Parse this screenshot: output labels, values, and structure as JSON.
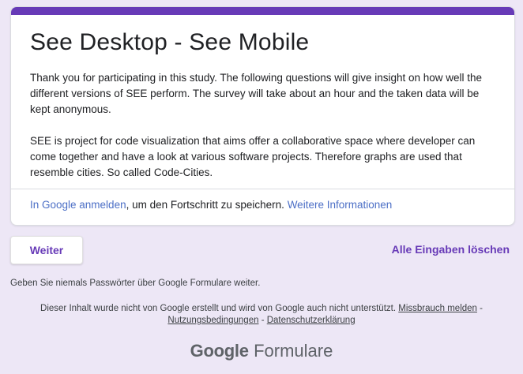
{
  "form": {
    "title": "See Desktop - See Mobile",
    "description": [
      "Thank you for participating in this study. The following questions will give insight on how well the different versions of SEE perform. The survey will take about an hour and the taken data will be kept anonymous.",
      "SEE is project for code visualization that aims offer a collaborative space where developer can come together and have a look at various software projects. Therefore graphs are used that resemble cities. So called Code-Cities."
    ],
    "signin": {
      "link_text": "In Google anmelden",
      "middle_text": ", um den Fortschritt zu speichern. ",
      "more_info_text": "Weitere Informationen"
    },
    "accent_color": "#673ab7",
    "background_color": "#ede7f6"
  },
  "actions": {
    "next_label": "Weiter",
    "clear_label": "Alle Eingaben löschen"
  },
  "warning": "Geben Sie niemals Passwörter über Google Formulare weiter.",
  "footer": {
    "disclaimer": "Dieser Inhalt wurde nicht von Google erstellt und wird von Google auch nicht unterstützt. ",
    "report_abuse": "Missbrauch melden",
    "sep1": " - ",
    "terms": "Nutzungsbedingungen",
    "sep2": " - ",
    "privacy": "Datenschutzerklärung"
  },
  "brand": {
    "google": "Google",
    "product": "Formulare"
  }
}
